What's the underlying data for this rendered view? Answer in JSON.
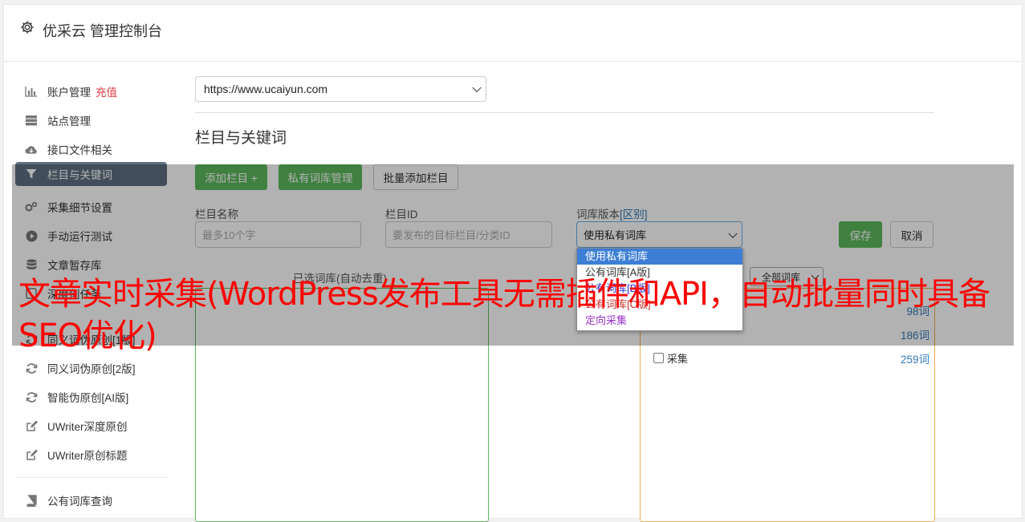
{
  "header": {
    "title": "优采云 管理控制台",
    "icon": "gear-icon"
  },
  "sidebar": {
    "items": [
      {
        "label": "账户管理",
        "badge": "充值",
        "icon": "bar-chart-icon"
      },
      {
        "label": "站点管理",
        "icon": "server-icon"
      },
      {
        "label": "接口文件相关",
        "icon": "cloud-download-icon"
      },
      {
        "label": "栏目与关键词",
        "icon": "filter-icon",
        "active": true
      },
      {
        "label": "采集细节设置",
        "icon": "gears-icon"
      },
      {
        "label": "手动运行测试",
        "icon": "play-circle-icon"
      },
      {
        "label": "文章暂存库",
        "icon": "database-icon"
      },
      {
        "label": "深度创任务",
        "icon": "task-icon"
      },
      {
        "label": "同义词伪原创[1版]",
        "icon": "refresh-icon"
      },
      {
        "label": "同义词伪原创[2版]",
        "icon": "refresh-icon"
      },
      {
        "label": "智能伪原创[AI版]",
        "icon": "refresh-icon"
      },
      {
        "label": "UWriter深度原创",
        "icon": "edit-icon"
      },
      {
        "label": "UWriter原创标题",
        "icon": "edit-icon"
      },
      {
        "label": "公有词库查询",
        "icon": "book-icon"
      }
    ]
  },
  "main": {
    "site_select": "https://www.ucaiyun.com",
    "section_title": "栏目与关键词",
    "buttons": {
      "add_column": "添加栏目 +",
      "private_lib": "私有词库管理",
      "batch_add": "批量添加栏目",
      "save": "保存",
      "cancel": "取消"
    },
    "form": {
      "name_label": "栏目名称",
      "name_placeholder": "最多10个字",
      "id_label": "栏目ID",
      "id_placeholder": "要发布的目标栏目/分类ID",
      "version_label": "词库版本",
      "version_diff": "[区别]",
      "version_value": "使用私有词库"
    },
    "dropdown_options": [
      {
        "label": "使用私有词库",
        "color": "#ffffff"
      },
      {
        "label": "公有词库[A版]",
        "color": "#333333"
      },
      {
        "label": "公有词库[B版]",
        "color": "#3333cc"
      },
      {
        "label": "公有词库[C版]",
        "color": "#cc3333"
      },
      {
        "label": "定向采集",
        "color": "#9933cc"
      }
    ],
    "selected_lib_title": "已选词库(自动去重)",
    "all_lib_select": "全部词库",
    "lib_rows": [
      {
        "name": "",
        "count": "98词"
      },
      {
        "name": "",
        "count": "186词"
      },
      {
        "name": "采集",
        "count": "259词"
      }
    ]
  },
  "overlay_text": "文章实时采集(WordPress发布工具无需插件和API，自动批量同时具备SEO优化)"
}
